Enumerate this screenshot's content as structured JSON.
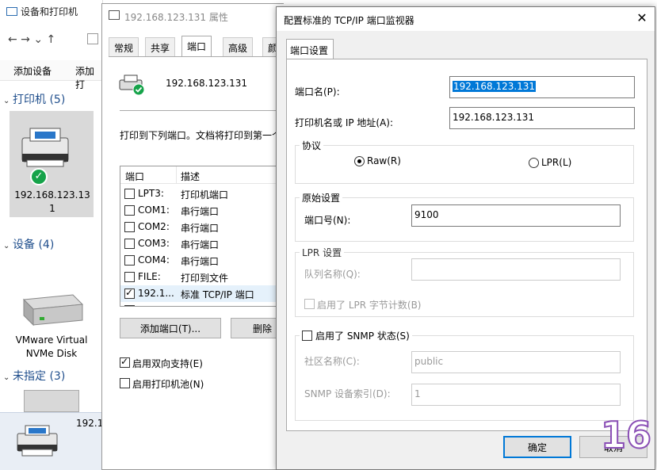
{
  "explorer": {
    "title": "设备和打印机",
    "nav": "← → ⌄ ↑",
    "toolbar": [
      "添加设备",
      "添加打"
    ],
    "groups": [
      {
        "label": "打印机 (5)"
      },
      {
        "label": "设备 (4)"
      },
      {
        "label": "未指定 (3)"
      }
    ],
    "printer_name_line1": "192.168.123.13",
    "printer_name_line2": "1",
    "disk_line1": "VMware Virtual",
    "disk_line2": "NVMe Disk",
    "bottom_item_partial": "192.1"
  },
  "props": {
    "title": "192.168.123.131 属性",
    "tabs": [
      "常规",
      "共享",
      "端口",
      "高级",
      "颜"
    ],
    "active_tab": "端口",
    "printer_name": "192.168.123.131",
    "instruction": "打印到下列端口。文档将打印到第一个",
    "columns": [
      "端口",
      "描述"
    ],
    "ports": [
      {
        "port": "LPT3:",
        "desc": "打印机端口",
        "checked": false
      },
      {
        "port": "COM1:",
        "desc": "串行端口",
        "checked": false
      },
      {
        "port": "COM2:",
        "desc": "串行端口",
        "checked": false
      },
      {
        "port": "COM3:",
        "desc": "串行端口",
        "checked": false
      },
      {
        "port": "COM4:",
        "desc": "串行端口",
        "checked": false
      },
      {
        "port": "FILE:",
        "desc": "打印到文件",
        "checked": false
      },
      {
        "port": "192.1...",
        "desc": "标准 TCP/IP 端口",
        "checked": true
      },
      {
        "port": "192.1...",
        "desc": "标准 TCP/IP 端口",
        "checked": false
      }
    ],
    "add_port_button": "添加端口(T)...",
    "delete_port_button": "删除",
    "bidirectional": {
      "label": "启用双向支持(E)",
      "checked": true
    },
    "pooling": {
      "label": "启用打印机池(N)",
      "checked": false
    }
  },
  "dialog": {
    "title": "配置标准的 TCP/IP 端口监视器",
    "tab": "端口设置",
    "port_name_label": "端口名(P):",
    "port_name_value": "192.168.123.131",
    "host_label": "打印机名或 IP 地址(A):",
    "host_value": "192.168.123.131",
    "protocol_title": "协议",
    "raw_label": "Raw(R)",
    "lpr_label": "LPR(L)",
    "protocol_selected": "Raw",
    "raw_settings_title": "原始设置",
    "port_number_label": "端口号(N):",
    "port_number_value": "9100",
    "lpr_settings_title": "LPR 设置",
    "queue_label": "队列名称(Q):",
    "queue_value": "",
    "lpr_byte_count_label": "启用了 LPR 字节计数(B)",
    "snmp_label": "启用了 SNMP 状态(S)",
    "snmp_checked": false,
    "community_label": "社区名称(C):",
    "community_value": "public",
    "snmp_index_label": "SNMP 设备索引(D):",
    "snmp_index_value": "1",
    "ok_button": "确定",
    "cancel_button": "取消"
  },
  "watermark": "16",
  "colors": {
    "accent": "#0078d7",
    "group_heading": "#1f4e8c",
    "success_green": "#16a34a"
  }
}
